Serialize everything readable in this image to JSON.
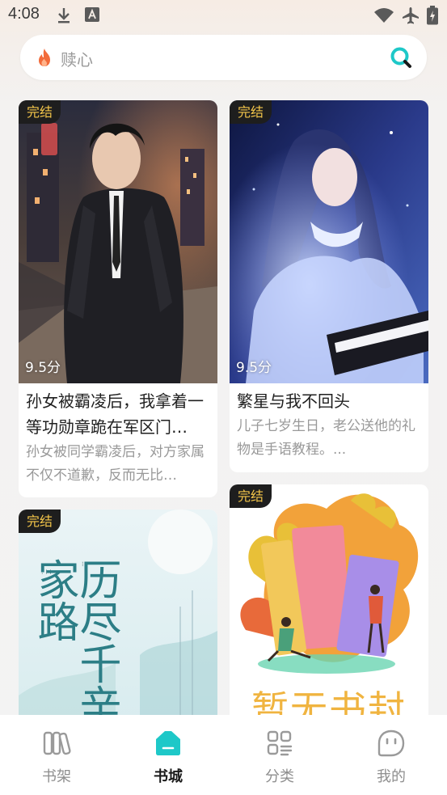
{
  "status_bar": {
    "time": "4:08"
  },
  "search": {
    "placeholder": "赎心"
  },
  "books": [
    {
      "badge": "完结",
      "score": "9.5分",
      "title": "孙女被霸凌后，我拿着一等功勋章跪在军区门…",
      "desc": "孙女被同学霸凌后，对方家属不仅不道歉，反而无比…"
    },
    {
      "badge": "完结",
      "score": "9.5分",
      "title": "繁星与我不回头",
      "desc": "儿子七岁生日，老公送他的礼物是手语教程。..."
    },
    {
      "badge": "完结",
      "cover_text": "历尽千辛回家路"
    },
    {
      "badge": "完结",
      "cover_text": "暂无书封"
    }
  ],
  "tabs": [
    {
      "label": "书架",
      "icon": "bookshelf-icon"
    },
    {
      "label": "书城",
      "icon": "bookstore-icon"
    },
    {
      "label": "分类",
      "icon": "category-icon"
    },
    {
      "label": "我的",
      "icon": "profile-icon"
    }
  ],
  "colors": {
    "accent": "#1ec8c8",
    "badge_text": "#f4c64a",
    "badge_bg": "#1e1e1e",
    "flame": "#f26b3a"
  }
}
